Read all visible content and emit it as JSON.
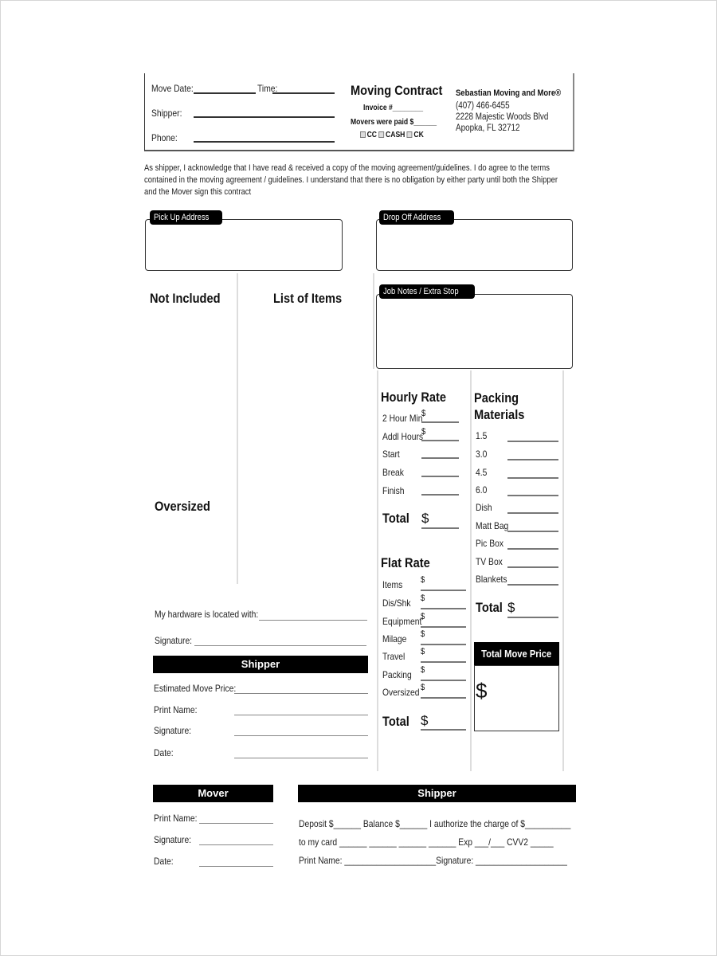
{
  "header": {
    "move_date_label": "Move Date:",
    "time_label": "Time:",
    "shipper_label": "Shipper:",
    "phone_label": "Phone:",
    "title": "Moving Contract",
    "invoice_label": "Invoice #________",
    "movers_paid_label": "Movers were paid $______",
    "payment_options": [
      "CC",
      "CASH",
      "CK"
    ],
    "company": {
      "name": "Sebastian Moving and More®",
      "phone": "(407) 466-6455",
      "street": "2228 Majestic Woods Blvd",
      "city": "Apopka, FL 32712"
    }
  },
  "acknowledgement": [
    "As shipper, I acknowledge that I have read & received a copy of the moving agreement/guidelines. I do agree to the terms",
    "contained in the moving agreement / guidelines. I understand that there is no obligation by either party until both the Shipper",
    "and the Mover sign this contract"
  ],
  "addresses": {
    "pickup_label": "Pick Up Address",
    "dropoff_label": "Drop Off Address",
    "job_notes_label": "Job Notes / Extra Stop"
  },
  "items": {
    "not_included": "Not Included",
    "list_of_items": "List of Items",
    "oversized": "Oversized"
  },
  "hourly_rate": {
    "title": "Hourly Rate",
    "rows": [
      {
        "label": "2 Hour Min",
        "prefix": "$"
      },
      {
        "label": "Addl Hours",
        "prefix": "$"
      },
      {
        "label": "Start",
        "prefix": ""
      },
      {
        "label": "Break",
        "prefix": ""
      },
      {
        "label": "Finish",
        "prefix": ""
      }
    ],
    "total_label": "Total",
    "total_prefix": "$"
  },
  "flat_rate": {
    "title": "Flat Rate",
    "rows": [
      {
        "label": "Items",
        "prefix": "$"
      },
      {
        "label": "Dis/Shk",
        "prefix": "$"
      },
      {
        "label": "Equipment",
        "prefix": "$"
      },
      {
        "label": "Milage",
        "prefix": "$"
      },
      {
        "label": "Travel",
        "prefix": "$"
      },
      {
        "label": "Packing",
        "prefix": "$"
      },
      {
        "label": "Oversized",
        "prefix": "$"
      }
    ],
    "total_label": "Total",
    "total_prefix": "$"
  },
  "packing_materials": {
    "title_line1": "Packing",
    "title_line2": "Materials",
    "rows": [
      "1.5",
      "3.0",
      "4.5",
      "6.0",
      "Dish",
      "Matt Bag",
      "Pic Box",
      "TV Box",
      "Blankets"
    ],
    "total_label": "Total",
    "total_prefix": "$"
  },
  "total_move_price": {
    "label": "Total Move Price",
    "prefix": "$"
  },
  "hardware": {
    "label": "My hardware is located with:",
    "signature_label": "Signature:"
  },
  "shipper_section": {
    "title": "Shipper",
    "fields": [
      "Estimated Move Price:",
      "Print Name:",
      "Signature:",
      "Date:"
    ]
  },
  "mover_section": {
    "title": "Mover",
    "fields": [
      "Print Name:",
      "Signature:",
      "Date:"
    ]
  },
  "shipper_payment": {
    "title": "Shipper",
    "lines": [
      "Deposit $______ Balance $______ I authorize the charge of $__________",
      "to my card ______ ______ ______ ______ Exp ___/___ CVV2 _____",
      "Print Name: ____________________Signature: ____________________"
    ]
  }
}
